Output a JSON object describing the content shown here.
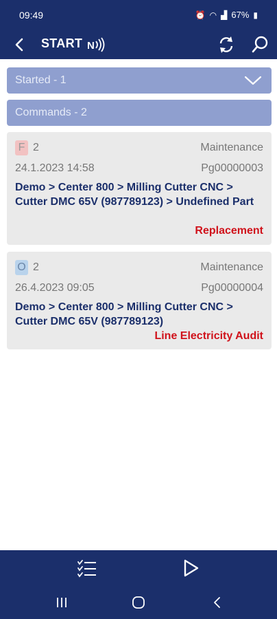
{
  "status_bar": {
    "time": "09:49",
    "battery": "67%"
  },
  "app_bar": {
    "title": "START"
  },
  "sections": [
    {
      "label": "Started - 1"
    },
    {
      "label": "Commands - 2"
    }
  ],
  "cards": [
    {
      "badge": "F",
      "count": "2",
      "type": "Maintenance",
      "date": "24.1.2023 14:58",
      "code": "Pg00000003",
      "path": "Demo > Center 800 > Milling Cutter CNC > Cutter DMC 65V (987789123) > Undefined Part",
      "action": "Replacement"
    },
    {
      "badge": "O",
      "count": "2",
      "type": "Maintenance",
      "date": "26.4.2023 09:05",
      "code": "Pg00000004",
      "path": "Demo > Center 800 > Milling Cutter CNC > Cutter DMC 65V (987789123)",
      "action": "Line Electricity Audit"
    }
  ],
  "colors": {
    "primary": "#1b2f6b",
    "section": "#8f9fcf",
    "card": "#eaeaea",
    "action": "#d0121b"
  }
}
